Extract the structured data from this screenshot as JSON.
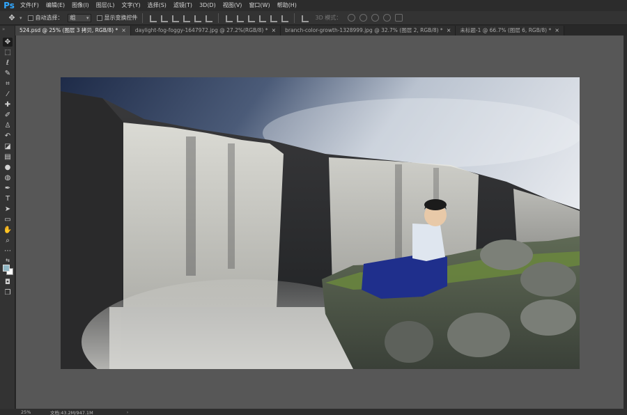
{
  "app": {
    "logo": "Ps"
  },
  "menu": [
    "文件(F)",
    "编辑(E)",
    "图像(I)",
    "图层(L)",
    "文字(Y)",
    "选择(S)",
    "滤镜(T)",
    "3D(D)",
    "视图(V)",
    "窗口(W)",
    "帮助(H)"
  ],
  "options": {
    "move_icon": "move-icon",
    "auto_select_label": "自动选择：",
    "auto_select_value": "组",
    "show_transform_label": "显示变换控件",
    "mode_3d_label": "3D 模式："
  },
  "tabs": [
    {
      "label": "524.psd @ 25% (图层 3 拷贝, RGB/8) *",
      "close": "×",
      "active": true
    },
    {
      "label": "daylight-fog-foggy-1647972.jpg @ 27.2%(RGB/8) *",
      "close": "×",
      "active": false
    },
    {
      "label": "branch-color-growth-1328999.jpg @ 32.7% (图层 2, RGB/8) *",
      "close": "×",
      "active": false
    },
    {
      "label": "未标题-1 @ 66.7% (图层 6, RGB/8) *",
      "close": "×",
      "active": false
    }
  ],
  "toolbar": {
    "collapse": "»",
    "tools": [
      "move",
      "marquee",
      "lasso",
      "quick-select",
      "crop",
      "eyedropper",
      "healing",
      "brush",
      "clone-stamp",
      "history-brush",
      "eraser",
      "gradient",
      "blur",
      "dodge",
      "pen",
      "type",
      "path-select",
      "rectangle",
      "hand",
      "zoom",
      "more",
      "default-colors",
      "swap-colors",
      "quick-mask",
      "screen-mode"
    ]
  },
  "colors": {
    "foreground": "#8fb6c4",
    "background": "#ffffff",
    "canvas_bg": "#575757",
    "accent": "#31a8ff"
  },
  "status": {
    "zoom": "25%",
    "doc": "文档:43.2M/947.1M",
    "arrow": "›"
  }
}
